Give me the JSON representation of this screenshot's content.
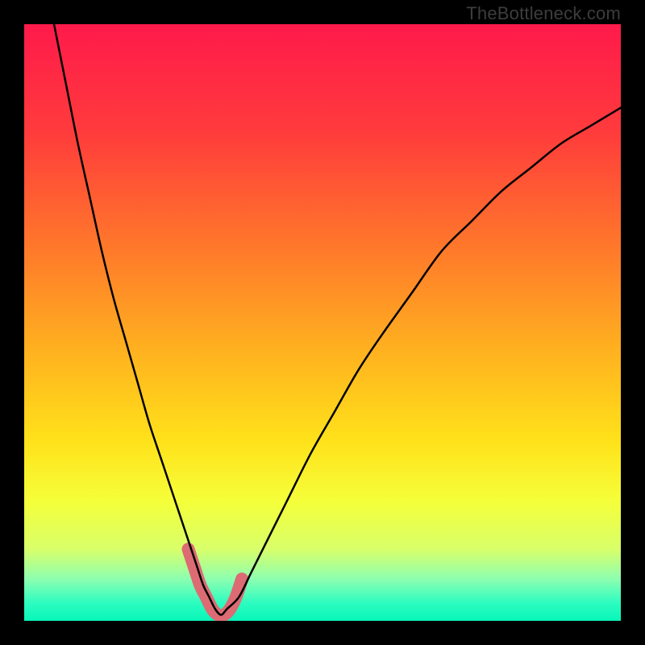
{
  "watermark": "TheBottleneck.com",
  "chart_data": {
    "type": "line",
    "title": "",
    "xlabel": "",
    "ylabel": "",
    "xlim": [
      0,
      100
    ],
    "ylim": [
      0,
      100
    ],
    "grid": false,
    "background_gradient": {
      "stops": [
        {
          "pos": 0.0,
          "color": "#ff1a4b"
        },
        {
          "pos": 0.18,
          "color": "#ff3b3c"
        },
        {
          "pos": 0.38,
          "color": "#ff7a2a"
        },
        {
          "pos": 0.55,
          "color": "#ffb21f"
        },
        {
          "pos": 0.7,
          "color": "#ffe21a"
        },
        {
          "pos": 0.8,
          "color": "#f5ff3a"
        },
        {
          "pos": 0.88,
          "color": "#d8ff6a"
        },
        {
          "pos": 0.93,
          "color": "#8dffb0"
        },
        {
          "pos": 0.97,
          "color": "#2dfcc0"
        },
        {
          "pos": 1.0,
          "color": "#08f6b9"
        }
      ]
    },
    "series": [
      {
        "name": "bottleneck-curve",
        "type": "line",
        "color": "#000000",
        "width": 2.5,
        "x": [
          5,
          7,
          9,
          11,
          13,
          15,
          17,
          19,
          21,
          23,
          25,
          27,
          28,
          29,
          30,
          31,
          32,
          33,
          34,
          36,
          38,
          40,
          44,
          48,
          52,
          56,
          60,
          65,
          70,
          75,
          80,
          85,
          90,
          95,
          100
        ],
        "y": [
          100,
          90,
          80,
          71,
          62,
          54,
          47,
          40,
          33,
          27,
          21,
          15,
          12,
          9,
          6,
          4,
          2,
          1,
          2,
          4,
          8,
          12,
          20,
          28,
          35,
          42,
          48,
          55,
          62,
          67,
          72,
          76,
          80,
          83,
          86
        ]
      },
      {
        "name": "min-highlight",
        "type": "line",
        "color": "#dc6b74",
        "width": 16,
        "linecap": "round",
        "x": [
          27.5,
          28.5,
          29.5,
          30.5,
          31.5,
          32.5,
          33.5,
          34.5,
          35.5,
          36.5
        ],
        "y": [
          12,
          9,
          6,
          4,
          2,
          1,
          1,
          2,
          4,
          7
        ]
      }
    ]
  }
}
